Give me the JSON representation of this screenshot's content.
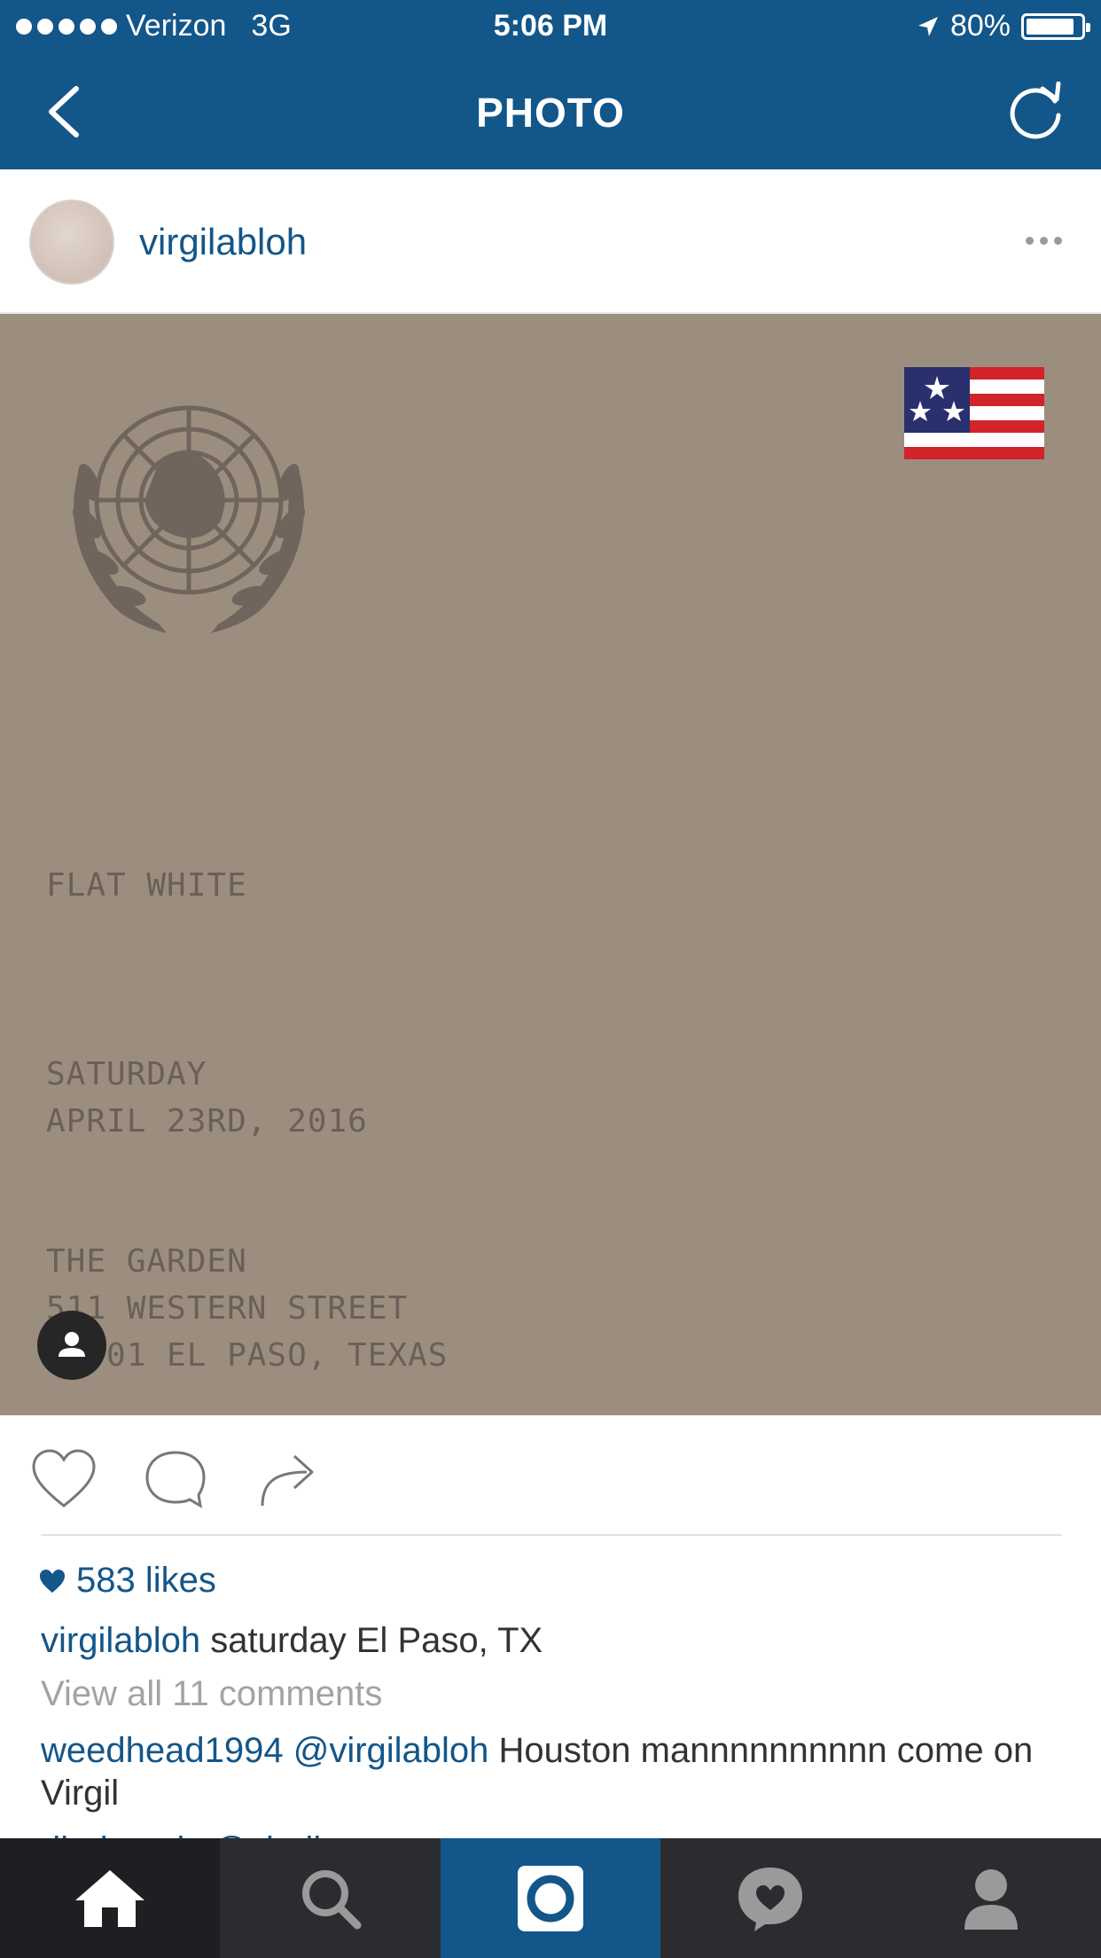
{
  "status_bar": {
    "carrier": "Verizon",
    "network": "3G",
    "time": "5:06 PM",
    "battery": "80%"
  },
  "nav": {
    "title": "PHOTO"
  },
  "post": {
    "username": "virgilabloh",
    "photo_text": {
      "line1": "FLAT WHITE",
      "line2": "SATURDAY",
      "line3": "APRIL 23RD, 2016",
      "line4": "THE GARDEN",
      "line5": "511 WESTERN STREET",
      "line6": "79901 EL PASO, TEXAS"
    },
    "likes": "583 likes",
    "caption_user": "virgilabloh",
    "caption_text": "saturday El Paso, TX",
    "view_all": "View all 11 comments",
    "comment_user": "weedhead1994",
    "comment_mention": "@virgilabloh",
    "comment_text": "Houston mannnnnnnnnn come on Virgil",
    "next_comment_preview": "djedwards @virgil"
  },
  "tabs": [
    "home-icon",
    "search-icon",
    "camera-icon",
    "activity-icon",
    "profile-icon"
  ],
  "colors": {
    "brand": "#135689",
    "photo_bg": "#9c8e7f",
    "tabbar": "#2b2c30"
  }
}
